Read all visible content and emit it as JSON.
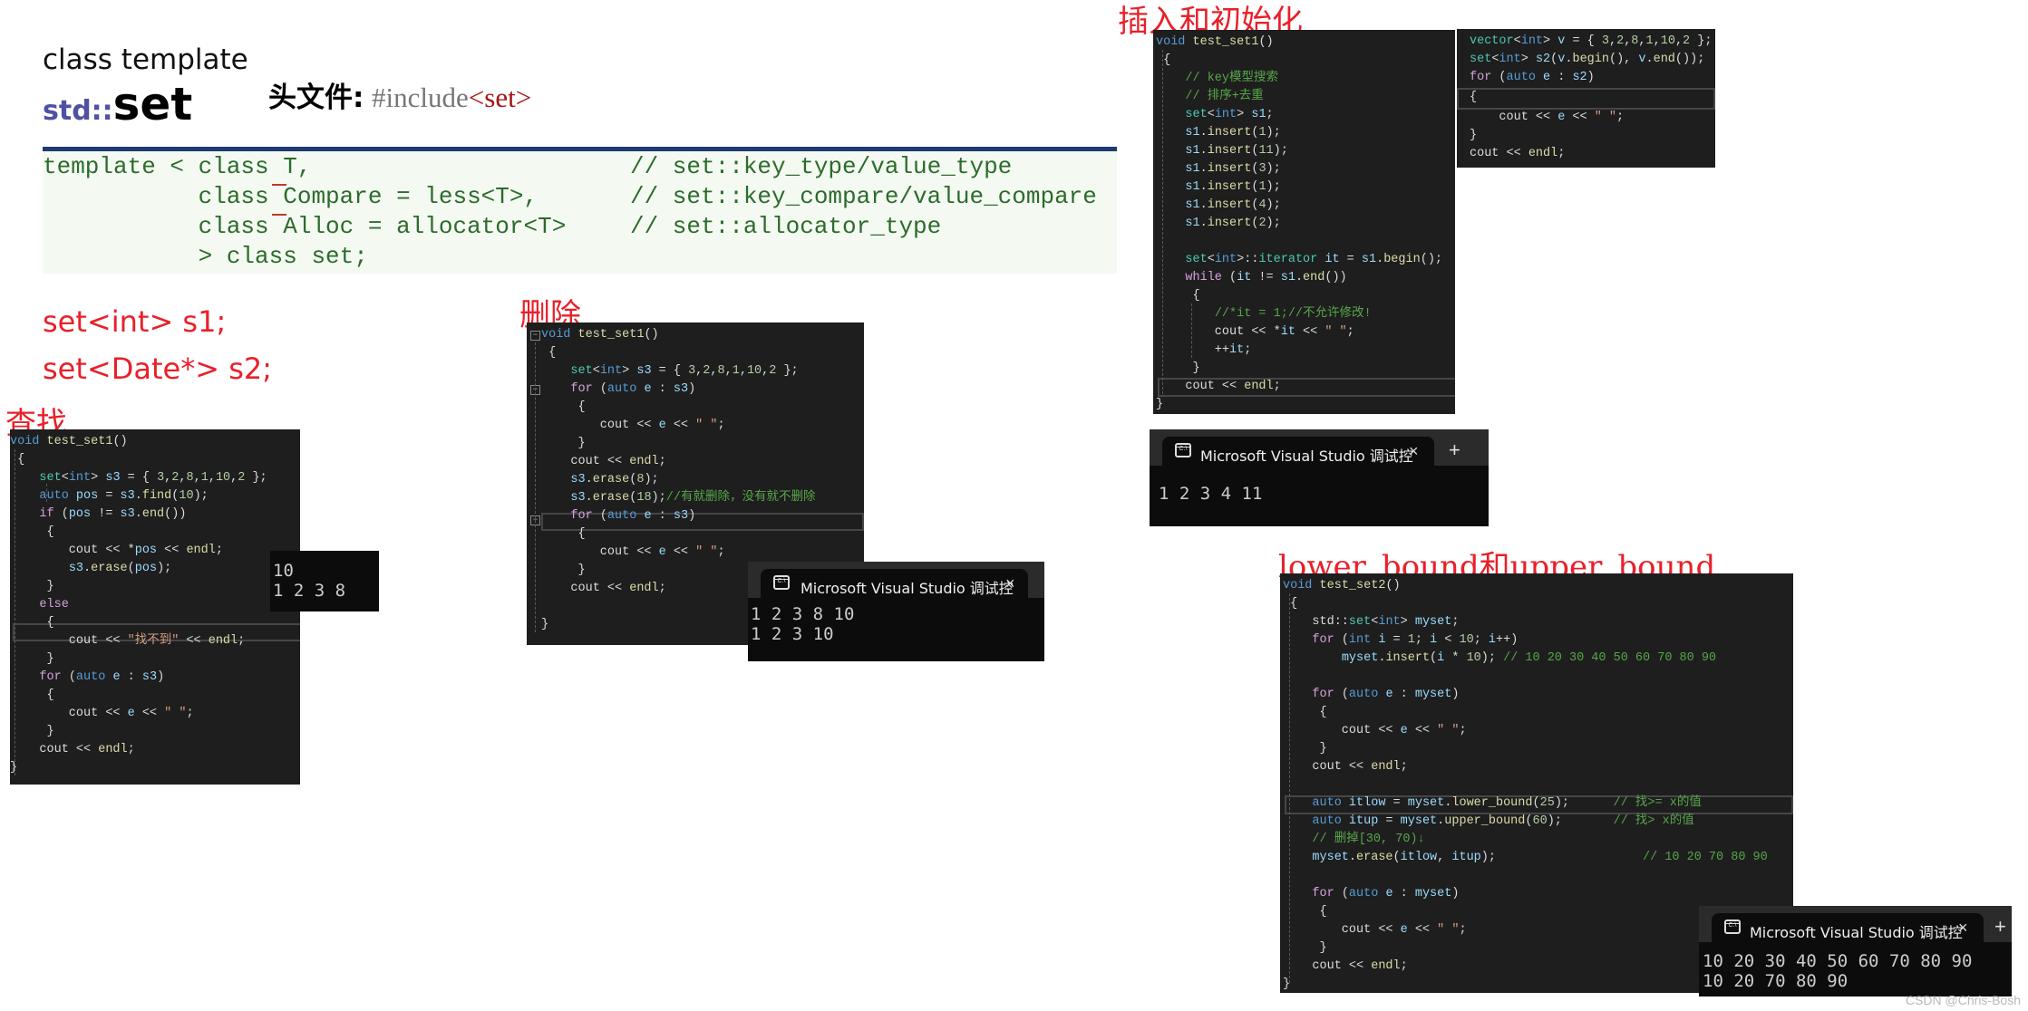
{
  "doc": {
    "class_template": "class template",
    "std_prefix": "std::",
    "set_name": "set",
    "header_label": "头文件:",
    "header_include": "#include",
    "header_target": "<set>"
  },
  "template_decl": {
    "lines": [
      "template < class T,",
      "           class Compare = less<T>,",
      "           class Alloc = allocator<T>",
      "           > class set;"
    ],
    "comments": [
      "// set::key_type/value_type",
      "// set::key_compare/value_compare",
      "// set::allocator_type"
    ]
  },
  "declarations": [
    "set<int> s1;",
    "set<Date*> s2;"
  ],
  "sections": {
    "find": "查找",
    "erase": "删除",
    "insert": "插入和初始化",
    "bounds": "lower_bound和upper_bound"
  },
  "find_code": [
    "void test_set1()",
    "{",
    "    set<int> s3 = { 3,2,8,1,10,2 };",
    "    auto pos = s3.find(10);",
    "    if (pos != s3.end())",
    "    {",
    "        cout << *pos << endl;",
    "        s3.erase(pos);",
    "    }",
    "    else",
    "    {",
    "        cout << \"找不到\" << endl;",
    "    }",
    "    for (auto e : s3)",
    "    {",
    "        cout << e << \" \";",
    "    }",
    "    cout << endl;",
    "}"
  ],
  "find_output": [
    "10",
    "1 2 3 8"
  ],
  "erase_code": [
    "void test_set1()",
    "{",
    "    set<int> s3 = { 3,2,8,1,10,2 };",
    "    for (auto e : s3)",
    "    {",
    "        cout << e << \" \";",
    "    }",
    "    cout << endl;",
    "    s3.erase(8);",
    "    s3.erase(18);//有就删除，没有就不删除",
    "    for (auto e : s3)",
    "    {",
    "        cout << e << \" \";",
    "    }",
    "    cout << endl;",
    "",
    "}"
  ],
  "erase_terminal": {
    "title": "Microsoft Visual Studio 调试控",
    "output": [
      "1 2 3 8 10",
      "1 2 3 10"
    ]
  },
  "insert_code": [
    "void test_set1()",
    "{",
    "    // key模型搜索",
    "    // 排序+去重",
    "    set<int> s1;",
    "    s1.insert(1);",
    "    s1.insert(11);",
    "    s1.insert(3);",
    "    s1.insert(1);",
    "    s1.insert(4);",
    "    s1.insert(2);",
    "",
    "    set<int>::iterator it = s1.begin();",
    "    while (it != s1.end())",
    "    {",
    "        //*it = 1;//不允许修改!",
    "        cout << *it << \" \";",
    "        ++it;",
    "    }",
    "    cout << endl;",
    "}"
  ],
  "init_code": [
    "vector<int> v = { 3,2,8,1,10,2 };",
    "set<int> s2(v.begin(), v.end());",
    "for (auto e : s2)",
    "{",
    "    cout << e << \" \";",
    "}",
    "cout << endl;"
  ],
  "insert_terminal": {
    "title": "Microsoft Visual Studio 调试控",
    "output": [
      "1 2 3 4 11"
    ]
  },
  "bounds_code": [
    "void test_set2()",
    "{",
    "    std::set<int> myset;",
    "    for (int i = 1; i < 10; i++)",
    "        myset.insert(i * 10); // 10 20 30 40 50 60 70 80 90",
    "",
    "    for (auto e : myset)",
    "    {",
    "        cout << e << \" \";",
    "    }",
    "    cout << endl;",
    "",
    "    auto itlow = myset.lower_bound(25);      // 找>= x的值",
    "    auto itup = myset.upper_bound(60);       // 找> x的值",
    "    // 删掉[30, 70)↓",
    "    myset.erase(itlow, itup);                    // 10 20 70 80 90",
    "",
    "    for (auto e : myset)",
    "    {",
    "        cout << e << \" \";",
    "    }",
    "    cout << endl;",
    "}"
  ],
  "bounds_terminal": {
    "title": "Microsoft Visual Studio 调试控",
    "output": [
      "10 20 30 40 50 60 70 80 90",
      "10 20 70 80 90"
    ]
  },
  "terminal_icons": {
    "tab_icon": "console-icon",
    "close": "×",
    "new_tab": "+"
  },
  "watermark": "CSDN @Chris-Bosh",
  "colors": {
    "section_title": "#e8202a",
    "rule": "#1e3a70",
    "template_text": "#2c6b2c",
    "editor_bg": "#1e1e1e",
    "terminal_bg": "#0c0c0c"
  }
}
